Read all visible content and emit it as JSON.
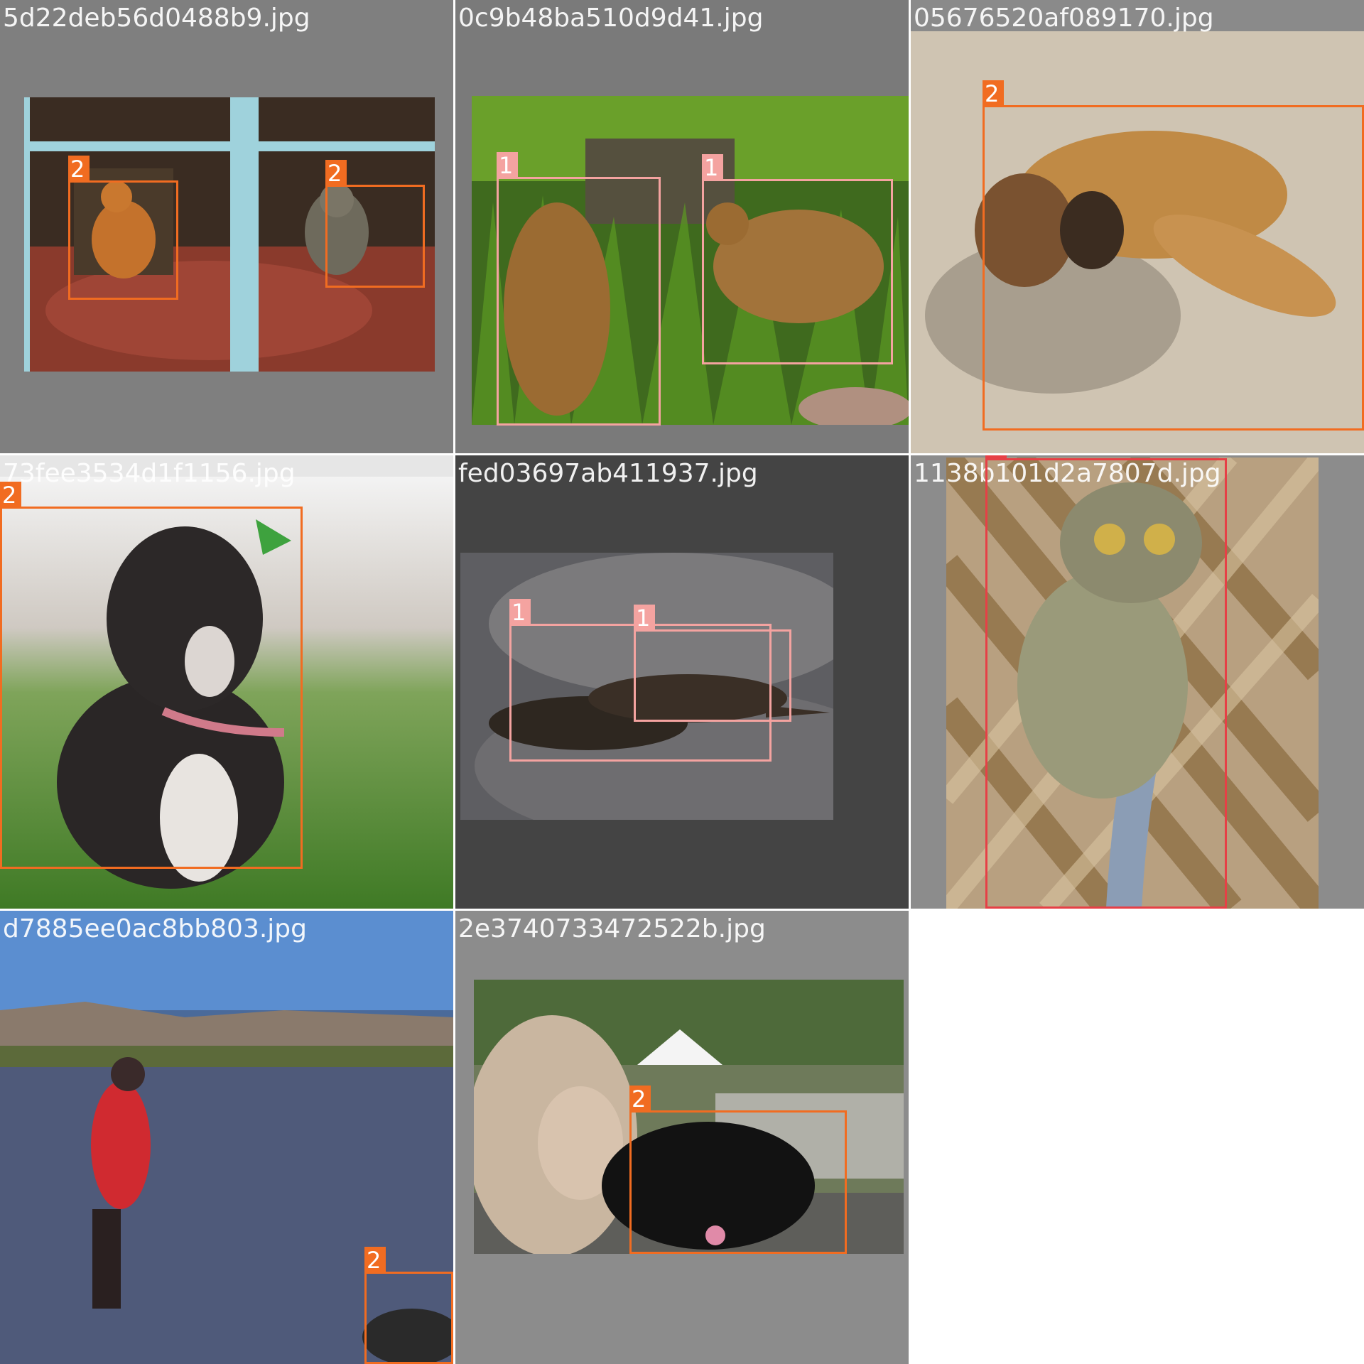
{
  "mosaic": {
    "images": [
      {
        "filename": "5d22deb56d0488b9.jpg",
        "scene": "two dogs seen through a window",
        "labels": [
          "2",
          "2"
        ]
      },
      {
        "filename": "0c9b48ba510d9d41.jpg",
        "scene": "two mongooses in tall grass",
        "labels": [
          "1",
          "1"
        ]
      },
      {
        "filename": "05676520af089170.jpg",
        "scene": "tan dog lying on dirt ground",
        "labels": [
          "2"
        ]
      },
      {
        "filename": "73fee3534d1f1156.jpg",
        "scene": "black and white long-haired dog sitting on grass",
        "labels": [
          "2"
        ]
      },
      {
        "filename": "fed03697ab411937.jpg",
        "scene": "otters on a rock",
        "labels": [
          "1",
          "1"
        ]
      },
      {
        "filename": "1138b101d2a7807d.jpg",
        "scene": "tarsier clinging to a branch",
        "labels": [
          "0"
        ]
      },
      {
        "filename": "d7885ee0ac8bb803.jpg",
        "scene": "person in red coat walking on beach with a dog",
        "labels": [
          "2"
        ]
      },
      {
        "filename": "2e3740733472522b.jpg",
        "scene": "woman holding a black dog outdoors",
        "labels": [
          "2"
        ]
      }
    ]
  },
  "colors": {
    "class_0": "#e64046",
    "class_1": "#f4a3a0",
    "class_2": "#f16c21"
  }
}
